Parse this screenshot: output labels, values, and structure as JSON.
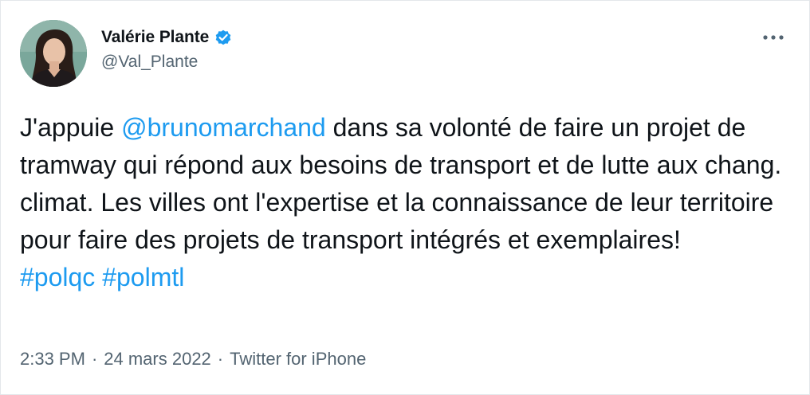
{
  "author": {
    "display_name": "Valérie Plante",
    "handle": "@Val_Plante",
    "verified": true,
    "avatar_icon": "profile-photo"
  },
  "menu_icon": "more-options-icon",
  "tweet": {
    "segments": [
      {
        "type": "text",
        "text": "J'appuie "
      },
      {
        "type": "mention",
        "text": "@brunomarchand"
      },
      {
        "type": "text",
        "text": " dans sa volonté de faire un projet de tramway qui répond aux besoins de transport et de lutte aux chang. climat. Les villes ont l'expertise et la connaissance de leur territoire pour faire des projets de transport intégrés et exemplaires!\n"
      },
      {
        "type": "hashtag",
        "text": "#polqc"
      },
      {
        "type": "text",
        "text": " "
      },
      {
        "type": "hashtag",
        "text": "#polmtl"
      }
    ]
  },
  "meta": {
    "time": "2:33 PM",
    "separator": "·",
    "date": "24 mars 2022",
    "source": "Twitter for iPhone"
  },
  "colors": {
    "link": "#1d9bf0",
    "text": "#0f1419",
    "secondary": "#536471",
    "verified": "#1d9bf0"
  }
}
